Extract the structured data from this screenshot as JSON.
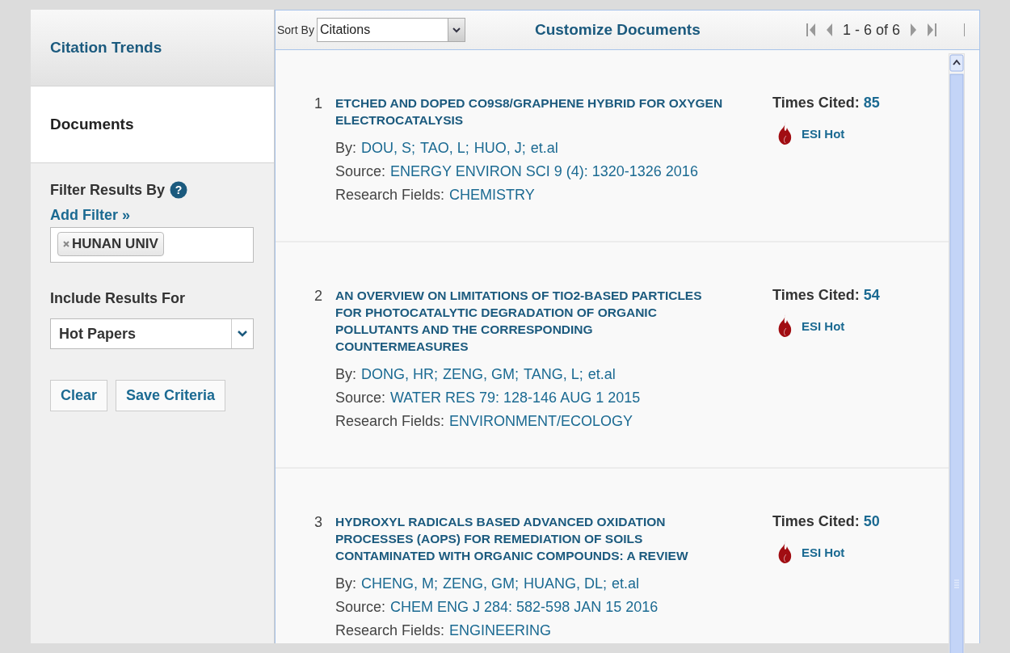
{
  "sidebar": {
    "tabs": [
      {
        "label": "Citation Trends",
        "selected": false
      },
      {
        "label": "Documents",
        "selected": true
      }
    ],
    "filter": {
      "title": "Filter Results By",
      "help": "?",
      "add_filter": "Add Filter »",
      "tags": [
        {
          "label": "HUNAN UNIV"
        }
      ]
    },
    "include": {
      "label": "Include Results For",
      "value": "Hot Papers"
    },
    "buttons": [
      "Clear",
      "Save Criteria"
    ]
  },
  "toolbar": {
    "sort_label": "Sort By",
    "sort_value": "Citations",
    "customize": "Customize Documents",
    "pager": "1 - 6 of 6"
  },
  "documents": [
    {
      "number": "1",
      "title": "ETCHED AND DOPED CO9S8/GRAPHENE HYBRID FOR OXYGEN ELECTROCATALYSIS",
      "by_label": "By:",
      "authors": [
        "DOU, S;",
        "TAO, L;",
        "HUO, J;",
        "et.al"
      ],
      "source_label": "Source:",
      "source": "ENERGY ENVIRON SCI 9 (4): 1320-1326 2016",
      "fields_label": "Research Fields:",
      "fields": "CHEMISTRY",
      "cited_label": "Times Cited:",
      "cited": "85",
      "hot": "ESI Hot"
    },
    {
      "number": "2",
      "title": "AN OVERVIEW ON LIMITATIONS OF TIO2-BASED PARTICLES FOR PHOTOCATALYTIC DEGRADATION OF ORGANIC POLLUTANTS AND THE CORRESPONDING COUNTERMEASURES",
      "by_label": "By:",
      "authors": [
        "DONG, HR;",
        "ZENG, GM;",
        "TANG, L;",
        "et.al"
      ],
      "source_label": "Source:",
      "source": "WATER RES 79: 128-146 AUG 1 2015",
      "fields_label": "Research Fields:",
      "fields": "ENVIRONMENT/ECOLOGY",
      "cited_label": "Times Cited:",
      "cited": "54",
      "hot": "ESI Hot"
    },
    {
      "number": "3",
      "title": "HYDROXYL RADICALS BASED ADVANCED OXIDATION PROCESSES (AOPS) FOR REMEDIATION OF SOILS CONTAMINATED WITH ORGANIC COMPOUNDS: A REVIEW",
      "by_label": "By:",
      "authors": [
        "CHENG, M;",
        "ZENG, GM;",
        "HUANG, DL;",
        "et.al"
      ],
      "source_label": "Source:",
      "source": "CHEM ENG J 284: 582-598 JAN 15 2016",
      "fields_label": "Research Fields:",
      "fields": "ENGINEERING",
      "cited_label": "Times Cited:",
      "cited": "50",
      "hot": "ESI Hot"
    }
  ]
}
